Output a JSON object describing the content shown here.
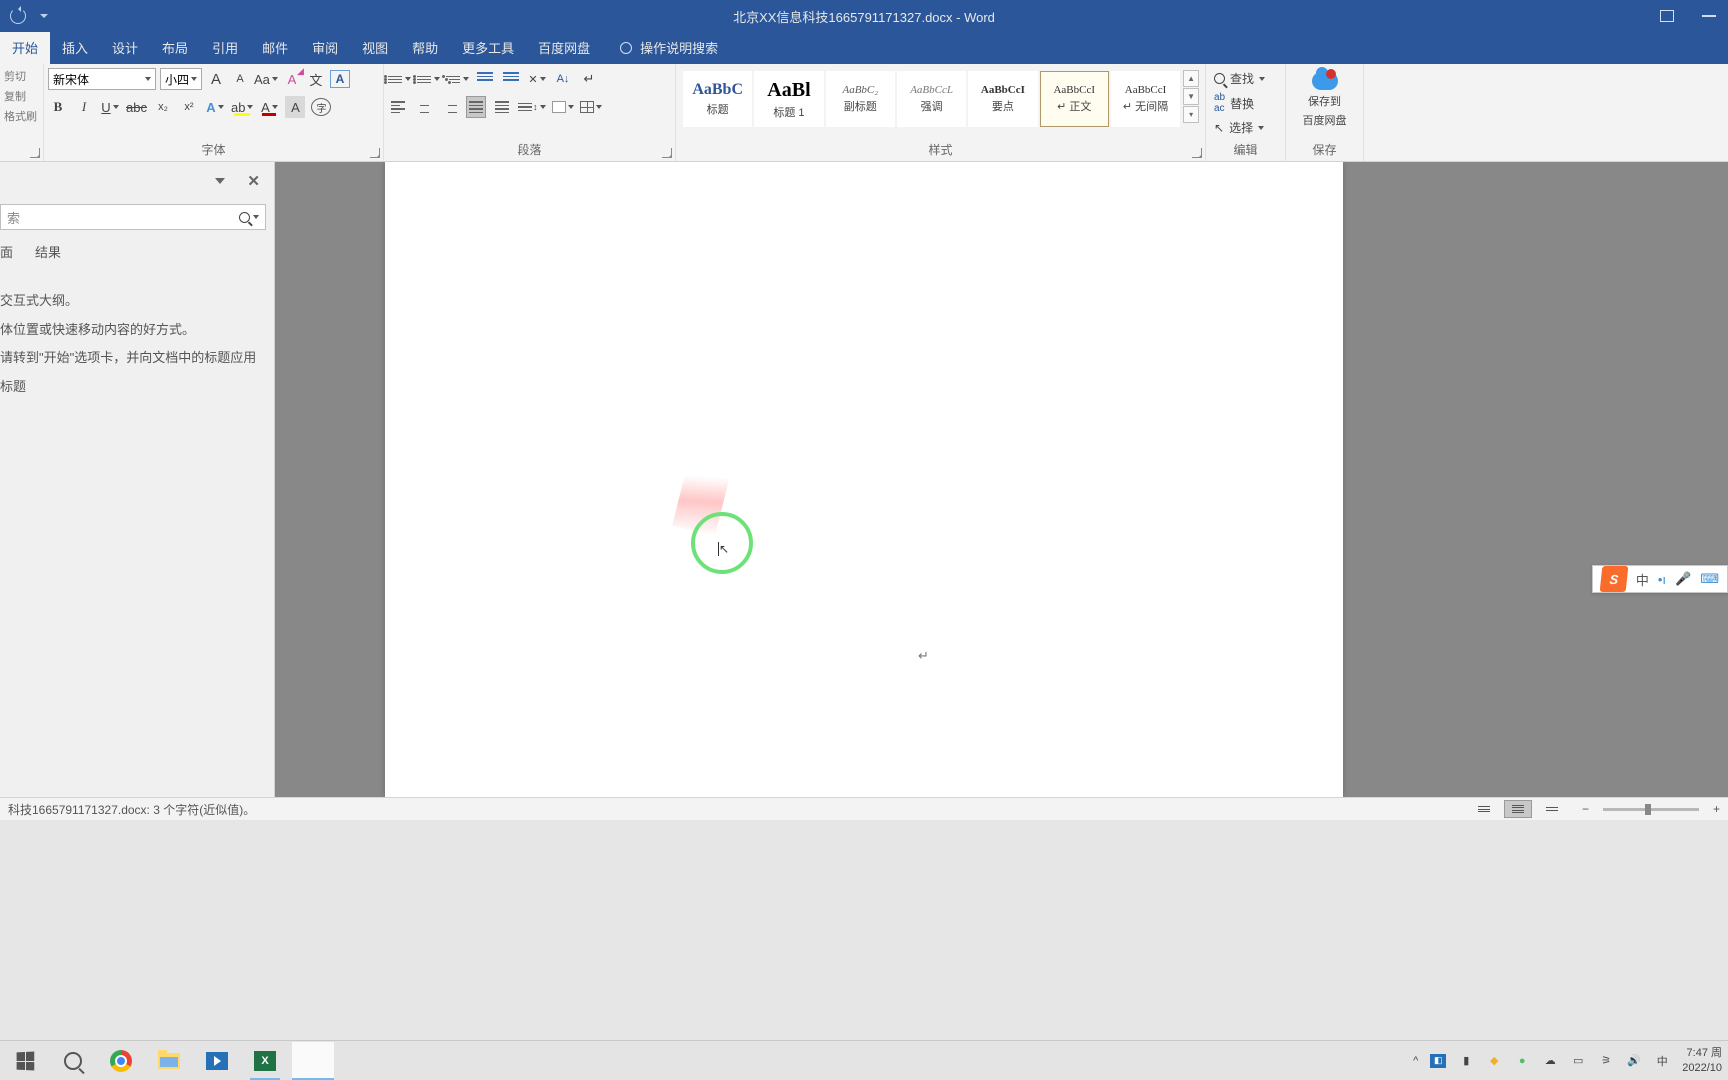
{
  "titlebar": {
    "title": "北京XX信息科技1665791171327.docx - Word"
  },
  "tabs": {
    "items": [
      "开始",
      "插入",
      "设计",
      "布局",
      "引用",
      "邮件",
      "审阅",
      "视图",
      "帮助",
      "更多工具",
      "百度网盘"
    ],
    "active": 0,
    "tellme": "操作说明搜索"
  },
  "ribbon": {
    "clipboard": {
      "cut": "剪切",
      "copy": "复制",
      "painter": "格式刷"
    },
    "font": {
      "label": "字体",
      "name": "新宋体",
      "size": "小四",
      "grow": "A",
      "shrink": "A",
      "case": "Aa",
      "clear": "✕",
      "phonetic": "文",
      "border": "A",
      "bold": "B",
      "italic": "I",
      "underline": "U",
      "strike": "abc",
      "sub": "x",
      "sup": "x",
      "effects": "A",
      "highlight": "ab",
      "color": "A",
      "shade": "A",
      "enclose": "字"
    },
    "paragraph": {
      "label": "段落"
    },
    "styles": {
      "label": "样式",
      "items": [
        {
          "preview": "AaBbC",
          "name": "标题",
          "cls": "heading"
        },
        {
          "preview": "AaBl",
          "name": "标题 1",
          "cls": "big"
        },
        {
          "preview": "AaBbC",
          "name": "副标题",
          "cls": "sub"
        },
        {
          "preview": "AaBbCcL",
          "name": "强调",
          "cls": ""
        },
        {
          "preview": "AaBbCcI",
          "name": "要点",
          "cls": ""
        },
        {
          "preview": "AaBbCcI",
          "name": "↵ 正文",
          "cls": ""
        },
        {
          "preview": "AaBbCcI",
          "name": "↵ 无间隔",
          "cls": ""
        }
      ],
      "selected": 5
    },
    "edit": {
      "label": "编辑",
      "find": "查找",
      "replace": "替换",
      "select": "选择"
    },
    "save": {
      "label": "保存",
      "line1": "保存到",
      "line2": "百度网盘"
    }
  },
  "navpane": {
    "search_placeholder": "索",
    "tabs": [
      "面",
      "结果"
    ],
    "body": [
      "交互式大纲。",
      "体位置或快速移动内容的好方式。",
      "请转到\"开始\"选项卡，并向文档中的标题应用标题"
    ]
  },
  "document": {
    "paragraph_mark": "↵"
  },
  "statusbar": {
    "text": "科技1665791171327.docx: 3 个字符(近似值)。"
  },
  "ime": {
    "lang": "中",
    "punct": "•ı"
  },
  "tray": {
    "time": "7:47 周",
    "date": "2022/10"
  },
  "taskbar": {
    "excel_letter": "X"
  }
}
